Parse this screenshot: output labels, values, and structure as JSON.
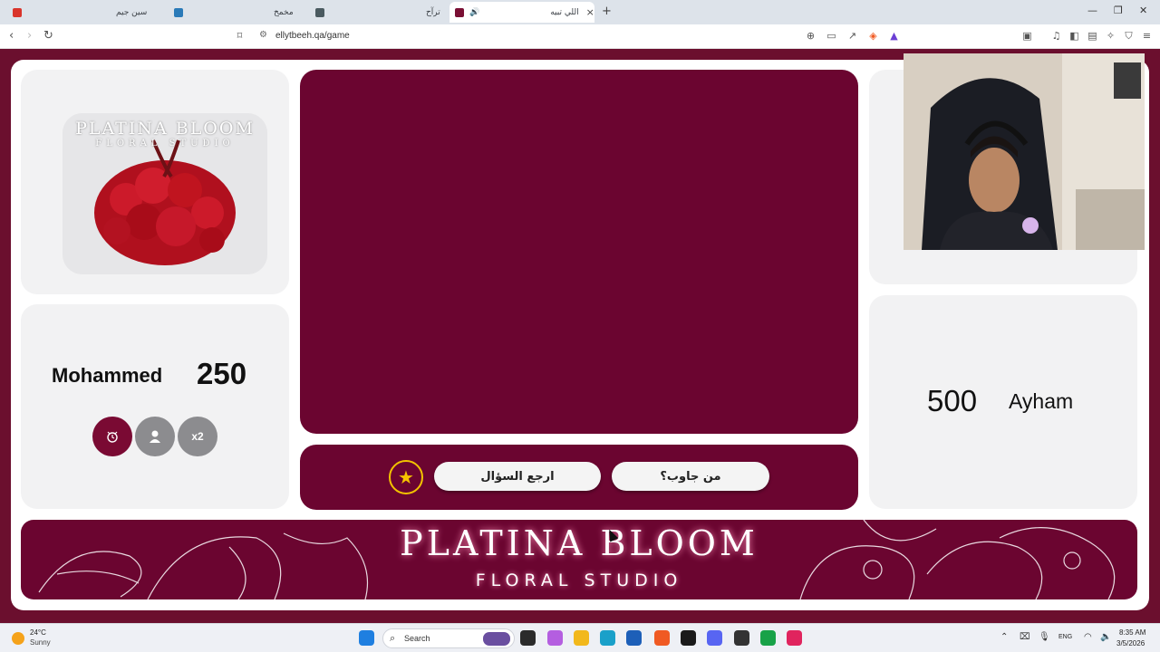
{
  "browser": {
    "tabs": [
      {
        "title": "سين جيم",
        "favicon_color": "#d9342b"
      },
      {
        "title": "مخمخ",
        "favicon_color": "#2a7ab8"
      },
      {
        "title": "ترآح",
        "favicon_color": "#4a5a60"
      },
      {
        "title": "اللي تبيه",
        "favicon_color": "#7a0f34",
        "active": true,
        "audio": true
      }
    ],
    "url": "ellytbeeh.qa/game"
  },
  "game": {
    "sponsor_logo": {
      "title": "PLATINA BLOOM",
      "subtitle": "FLORAL STUDIO"
    },
    "team_left": {
      "name": "Mohammed",
      "score": "250"
    },
    "team_right": {
      "name": "Ayham",
      "score": "500"
    },
    "helpers": [
      {
        "icon": "alarm-icon",
        "color": "#7a0a33"
      },
      {
        "icon": "person-icon",
        "color": "#8c8c8f"
      },
      {
        "label": "x2",
        "color": "#8c8c8f"
      }
    ],
    "controls": {
      "back_label": "ارجع السؤال",
      "who_answered_label": "من جاوب؟"
    },
    "banner": {
      "title": "PLATINA BLOOM",
      "subtitle": "FLORAL STUDIO"
    },
    "accent_color": "#6b0530"
  },
  "taskbar": {
    "weather_temp": "24°C",
    "weather_cond": "Sunny",
    "search_placeholder": "Search",
    "language": "ENG",
    "time": "8:35 AM",
    "date": "3/5/2026"
  }
}
